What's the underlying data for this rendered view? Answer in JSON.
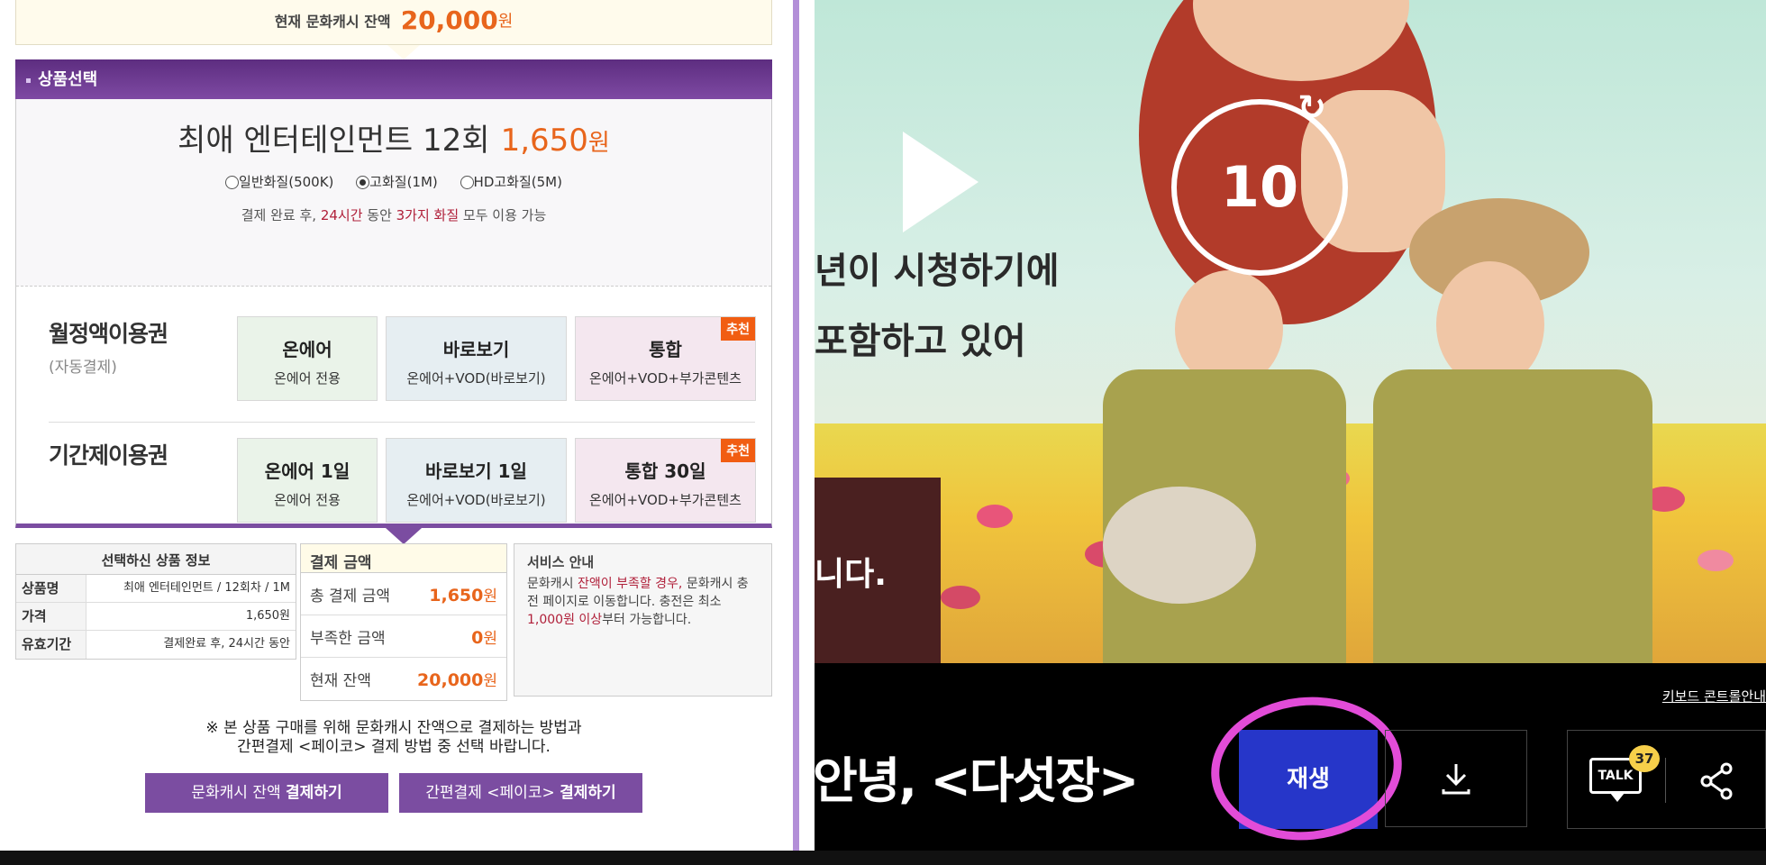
{
  "balance": {
    "label": "현재 문화캐시 잔액",
    "amount": "20,000",
    "unit": "원"
  },
  "section_title": "상품선택",
  "product": {
    "name": "최애 엔터테인먼트 12회",
    "price": "1,650",
    "unit": "원"
  },
  "quality_options": [
    {
      "label": "일반화질(500K)",
      "selected": false
    },
    {
      "label": "고화질(1M)",
      "selected": true
    },
    {
      "label": "HD고화질(5M)",
      "selected": false
    }
  ],
  "note": {
    "pre": "결제 완료 후, ",
    "hours": "24시간",
    "mid": " 동안 ",
    "types": "3가지 화질",
    "post": " 모두 이용 가능"
  },
  "monthly": {
    "title": "월정액이용권",
    "sub": "(자동결제)",
    "cards": [
      {
        "title": "온에어",
        "desc": "온에어 전용",
        "badge": ""
      },
      {
        "title": "바로보기",
        "desc": "온에어+VOD(바로보기)",
        "badge": ""
      },
      {
        "title": "통합",
        "desc": "온에어+VOD+부가콘텐츠",
        "badge": "추천"
      }
    ]
  },
  "period": {
    "title": "기간제이용권",
    "cards": [
      {
        "title": "온에어 1일",
        "desc": "온에어 전용",
        "badge": ""
      },
      {
        "title": "바로보기 1일",
        "desc": "온에어+VOD(바로보기)",
        "badge": ""
      },
      {
        "title": "통합 30일",
        "desc": "온에어+VOD+부가콘텐츠",
        "badge": "추천"
      }
    ]
  },
  "selected_info": {
    "header": "선택하신 상품 정보",
    "rows": [
      {
        "k": "상품명",
        "v": "최애 엔터테인먼트 / 12회차 / 1M"
      },
      {
        "k": "가격",
        "v": "1,650원"
      },
      {
        "k": "유효기간",
        "v": "결제완료 후, 24시간 동안"
      }
    ]
  },
  "payment": {
    "header": "결제 금액",
    "rows": [
      {
        "k": "총 결제 금액",
        "v": "1,650",
        "u": "원"
      },
      {
        "k": "부족한 금액",
        "v": "0",
        "u": "원"
      },
      {
        "k": "현재 잔액",
        "v": "20,000",
        "u": "원"
      }
    ]
  },
  "service": {
    "title": "서비스 안내",
    "l1a": "문화캐시 ",
    "l1b": "잔액이 부족할 경우,",
    "l1c": " 문화캐시 충전 페이지로 이동합니다. 충전은 최소 ",
    "l1d": "1,000원 이상",
    "l1e": "부터 가능합니다."
  },
  "guide": {
    "line1": "※ 본 상품 구매를 위해 문화캐시 잔액으로 결제하는 방법과",
    "line2": "간편결제 <페이코> 결제 방법 중 선택 바랍니다."
  },
  "buttons": {
    "cash_pre": "문화캐시 잔액 ",
    "cash_bold": "결제하기",
    "payco_pre": "간편결제 <페이코> ",
    "payco_bold": "결제하기"
  },
  "video": {
    "sub1": "년이 시청하기에",
    "sub2": "포함하고 있어",
    "sub3": "니다.",
    "skip": "10"
  },
  "controls": {
    "keyboard_help": "키보드 콘트롤안내",
    "title": "안녕, <다섯장>",
    "play": "재생",
    "talk": "TALK",
    "talk_count": "37"
  },
  "colors": {
    "accent_purple": "#7b4da1",
    "orange": "#e8651c",
    "play_blue": "#2636c9",
    "highlight": "#e24cd8"
  }
}
